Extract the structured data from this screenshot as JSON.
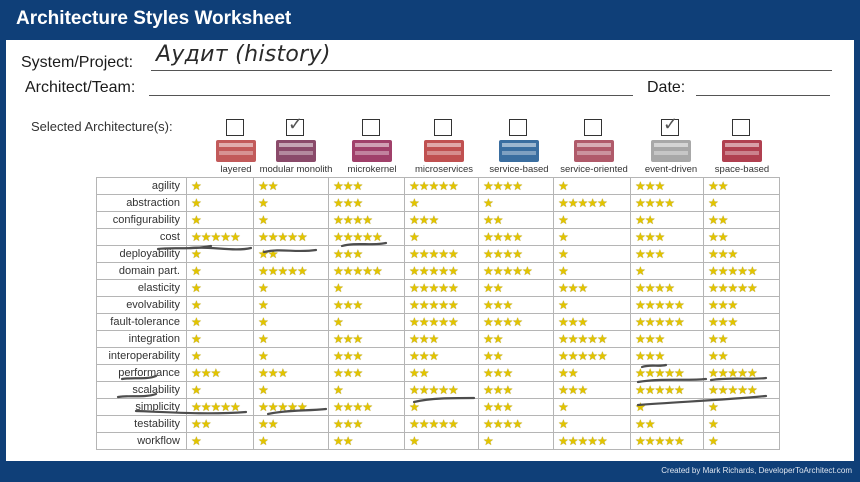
{
  "header": {
    "title": "Architecture Styles Worksheet"
  },
  "fields": {
    "system_label": "System/Project:",
    "system_value": "Аудит (history)",
    "team_label": "Architect/Team:",
    "date_label": "Date:"
  },
  "selected_label": "Selected Architecture(s):",
  "styles": [
    {
      "name": "layered",
      "checked": false,
      "color": "#c25a5a"
    },
    {
      "name": "modular monolith",
      "checked": true,
      "color": "#8a4a6a"
    },
    {
      "name": "microkernel",
      "checked": false,
      "color": "#a0406a"
    },
    {
      "name": "microservices",
      "checked": false,
      "color": "#c05050"
    },
    {
      "name": "service-based",
      "checked": false,
      "color": "#3a6ea0"
    },
    {
      "name": "service-oriented",
      "checked": false,
      "color": "#b05a6a"
    },
    {
      "name": "event-driven",
      "checked": true,
      "color": "#a8a8a8"
    },
    {
      "name": "space-based",
      "checked": false,
      "color": "#b04050"
    }
  ],
  "rows": [
    {
      "attribute": "agility",
      "ratings": [
        "★",
        "★★",
        "★★★",
        "★★★★★",
        "★★★★",
        "★",
        "★★★",
        "★★"
      ]
    },
    {
      "attribute": "abstraction",
      "ratings": [
        "★",
        "★",
        "★★★",
        "★",
        "★",
        "★★★★★",
        "★★★★",
        "★"
      ]
    },
    {
      "attribute": "configurability",
      "ratings": [
        "★",
        "★",
        "★★★★",
        "★★★",
        "★★",
        "★",
        "★★",
        "★★"
      ]
    },
    {
      "attribute": "cost",
      "ratings": [
        "★★★★★",
        "★★★★★",
        "★★★★★",
        "★",
        "★★★★",
        "★",
        "★★★",
        "★★"
      ]
    },
    {
      "attribute": "deployability",
      "ratings": [
        "★",
        "★★",
        "★★★",
        "★★★★★",
        "★★★★",
        "★",
        "★★★",
        "★★★"
      ]
    },
    {
      "attribute": "domain part.",
      "ratings": [
        "★",
        "★★★★★",
        "★★★★★",
        "★★★★★",
        "★★★★★",
        "★",
        "★",
        "★★★★★"
      ]
    },
    {
      "attribute": "elasticity",
      "ratings": [
        "★",
        "★",
        "★",
        "★★★★★",
        "★★",
        "★★★",
        "★★★★",
        "★★★★★"
      ]
    },
    {
      "attribute": "evolvability",
      "ratings": [
        "★",
        "★",
        "★★★",
        "★★★★★",
        "★★★",
        "★",
        "★★★★★",
        "★★★"
      ]
    },
    {
      "attribute": "fault-tolerance",
      "ratings": [
        "★",
        "★",
        "★",
        "★★★★★",
        "★★★★",
        "★★★",
        "★★★★★",
        "★★★"
      ]
    },
    {
      "attribute": "integration",
      "ratings": [
        "★",
        "★",
        "★★★",
        "★★★",
        "★★",
        "★★★★★",
        "★★★",
        "★★"
      ]
    },
    {
      "attribute": "interoperability",
      "ratings": [
        "★",
        "★",
        "★★★",
        "★★★",
        "★★",
        "★★★★★",
        "★★★",
        "★★"
      ]
    },
    {
      "attribute": "performance",
      "ratings": [
        "★★★",
        "★★★",
        "★★★",
        "★★",
        "★★★",
        "★★",
        "★★★★★",
        "★★★★★"
      ]
    },
    {
      "attribute": "scalability",
      "ratings": [
        "★",
        "★",
        "★",
        "★★★★★",
        "★★★",
        "★★★",
        "★★★★★",
        "★★★★★"
      ]
    },
    {
      "attribute": "simplicity",
      "ratings": [
        "★★★★★",
        "★★★★★",
        "★★★★",
        "★",
        "★★★",
        "★",
        "★",
        "★"
      ]
    },
    {
      "attribute": "testability",
      "ratings": [
        "★★",
        "★★",
        "★★★",
        "★★★★★",
        "★★★★",
        "★",
        "★★",
        "★"
      ]
    },
    {
      "attribute": "workflow",
      "ratings": [
        "★",
        "★",
        "★★",
        "★",
        "★",
        "★★★★★",
        "★★★★★",
        "★"
      ]
    }
  ],
  "footer": {
    "credit": "Created by Mark Richards, DeveloperToArchitect.com"
  }
}
